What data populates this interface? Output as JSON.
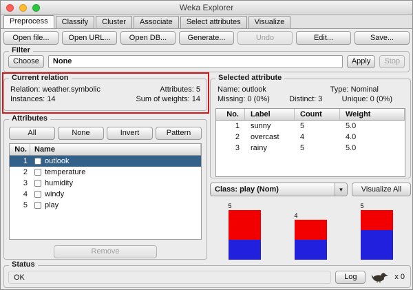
{
  "window": {
    "title": "Weka Explorer"
  },
  "colors": {
    "annotation_red": "#d21717",
    "selected_row": "#33618a",
    "traffic_red": "#ff5f57",
    "traffic_yellow": "#febc2e",
    "traffic_green": "#28c840"
  },
  "tabs": [
    {
      "label": "Preprocess"
    },
    {
      "label": "Classify"
    },
    {
      "label": "Cluster"
    },
    {
      "label": "Associate"
    },
    {
      "label": "Select attributes"
    },
    {
      "label": "Visualize"
    }
  ],
  "toolbar": {
    "open_file": "Open file...",
    "open_url": "Open URL...",
    "open_db": "Open DB...",
    "generate": "Generate...",
    "undo": "Undo",
    "edit": "Edit...",
    "save": "Save..."
  },
  "filter": {
    "title": "Filter",
    "choose": "Choose",
    "value": "None",
    "apply": "Apply",
    "stop": "Stop"
  },
  "current_relation": {
    "title": "Current relation",
    "relation": "Relation: weather.symbolic",
    "attributes": "Attributes: 5",
    "instances": "Instances: 14",
    "sum_of_weights": "Sum of weights: 14"
  },
  "attributes_panel": {
    "title": "Attributes",
    "buttons": {
      "all": "All",
      "none": "None",
      "invert": "Invert",
      "pattern": "Pattern"
    },
    "columns": [
      "No.",
      "Name"
    ],
    "rows": [
      {
        "no": "1",
        "name": "outlook"
      },
      {
        "no": "2",
        "name": "temperature"
      },
      {
        "no": "3",
        "name": "humidity"
      },
      {
        "no": "4",
        "name": "windy"
      },
      {
        "no": "5",
        "name": "play"
      }
    ],
    "remove": "Remove"
  },
  "selected_attribute": {
    "title": "Selected attribute",
    "name": "Name: outlook",
    "type": "Type: Nominal",
    "missing": "Missing: 0 (0%)",
    "distinct": "Distinct: 3",
    "unique": "Unique: 0 (0%)",
    "columns": [
      "No.",
      "Label",
      "Count",
      "Weight"
    ],
    "rows": [
      {
        "no": "1",
        "label": "sunny",
        "count": "5",
        "weight": "5.0"
      },
      {
        "no": "2",
        "label": "overcast",
        "count": "4",
        "weight": "4.0"
      },
      {
        "no": "3",
        "label": "rainy",
        "count": "5",
        "weight": "5.0"
      }
    ]
  },
  "class_selector": {
    "value": "Class: play (Nom)",
    "visualize_all": "Visualize All"
  },
  "chart_data": {
    "type": "bar",
    "stacked": true,
    "title": "Distribution of attribute outlook, class-coloured by play",
    "categories": [
      "sunny",
      "overcast",
      "rainy"
    ],
    "totals": [
      5,
      4,
      5
    ],
    "bar_labels": [
      "5",
      "4",
      "5"
    ],
    "y_max": 5,
    "legend": "none",
    "axes": "none",
    "series": [
      {
        "name": "class-segment-red",
        "color": "#f20000",
        "values": [
          3,
          2,
          2
        ]
      },
      {
        "name": "class-segment-blue",
        "color": "#2020dd",
        "values": [
          2,
          2,
          3
        ]
      }
    ]
  },
  "status_bar": {
    "title": "Status",
    "message": "OK",
    "log": "Log",
    "counter": "x 0"
  }
}
